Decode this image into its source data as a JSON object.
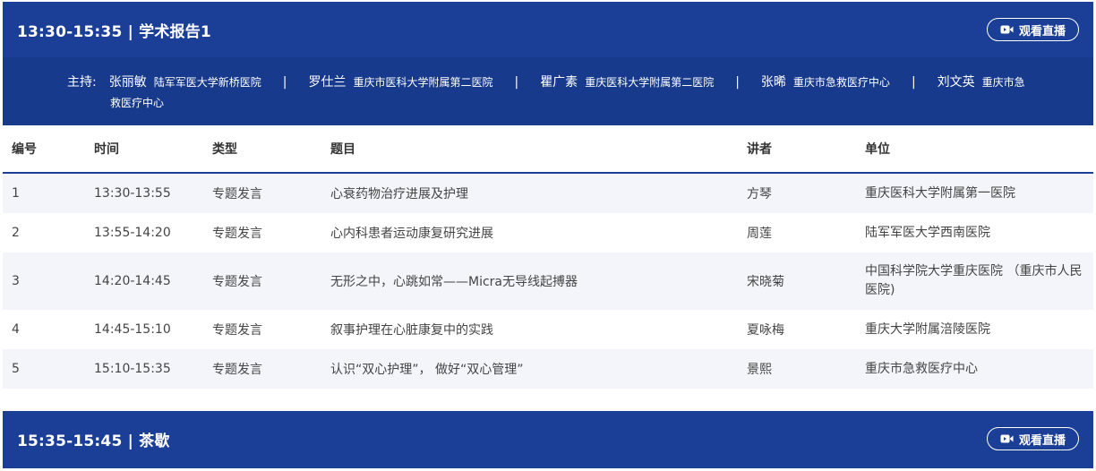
{
  "session1": {
    "title": "13:30-15:35 | 学术报告1",
    "live_label": "观看直播",
    "hosts_label": "主持:",
    "hosts": [
      {
        "name": "张丽敏",
        "org": "陆军军医大学新桥医院"
      },
      {
        "name": "罗仕兰",
        "org": "重庆市医科大学附属第二医院"
      },
      {
        "name": "瞿广素",
        "org": "重庆医科大学附属第二医院"
      },
      {
        "name": "张晞",
        "org": "重庆市急救医疗中心"
      },
      {
        "name": "刘文英",
        "org": "重庆市急"
      }
    ],
    "hosts_wrap": "救医疗中心"
  },
  "table": {
    "headers": [
      "编号",
      "时间",
      "类型",
      "题目",
      "讲者",
      "单位"
    ],
    "rows": [
      {
        "num": "1",
        "time": "13:30-13:55",
        "type": "专题发言",
        "topic": "心衰药物治疗进展及护理",
        "speaker": "方琴",
        "unit": "重庆医科大学附属第一医院"
      },
      {
        "num": "2",
        "time": "13:55-14:20",
        "type": "专题发言",
        "topic": "心内科患者运动康复研究进展",
        "speaker": "周莲",
        "unit": "陆军军医大学西南医院"
      },
      {
        "num": "3",
        "time": "14:20-14:45",
        "type": "专题发言",
        "topic": "无形之中，心跳如常——Micra无导线起搏器",
        "speaker": "宋晓菊",
        "unit": "中国科学院大学重庆医院 （重庆市人民医院)"
      },
      {
        "num": "4",
        "time": "14:45-15:10",
        "type": "专题发言",
        "topic": "叙事护理在心脏康复中的实践",
        "speaker": "夏咏梅",
        "unit": "重庆大学附属涪陵医院"
      },
      {
        "num": "5",
        "time": "15:10-15:35",
        "type": "专题发言",
        "topic": "认识“双心护理”， 做好“双心管理”",
        "speaker": "景熙",
        "unit": "重庆市急救医疗中心"
      }
    ]
  },
  "session2": {
    "title": "15:35-15:45 | 茶歇",
    "live_label": "观看直播"
  },
  "colors": {
    "header_blue": "#1b3f97",
    "hosts_blue": "#173a8c",
    "row_alt": "#f3f5fa"
  },
  "icons": {
    "live": "video-camera-icon"
  }
}
